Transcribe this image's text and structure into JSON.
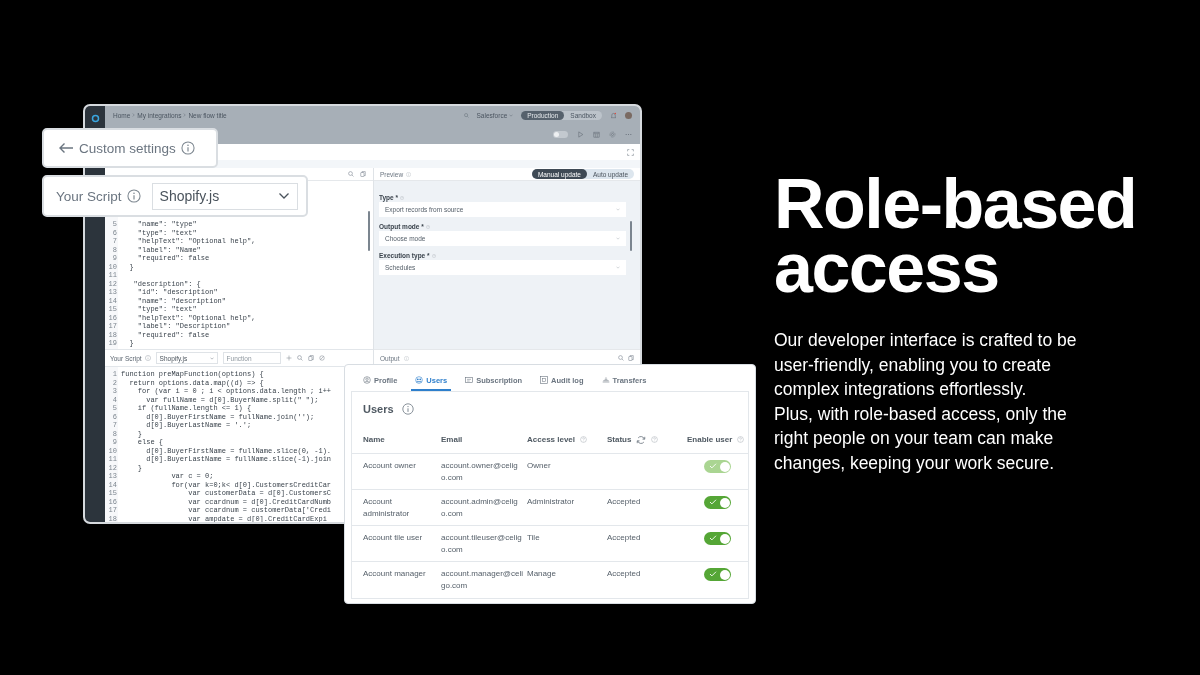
{
  "window": {
    "breadcrumb": [
      "Home",
      "My integrations",
      "New flow title"
    ],
    "account_menu": "Salesforce",
    "environments": [
      {
        "label": "Production",
        "selected": true
      },
      {
        "label": "Sandbox",
        "selected": false
      }
    ],
    "flow_toggle": {
      "on": false
    },
    "editor_lines": [
      {
        "number": "5",
        "code": "    \"name\": \"type\""
      },
      {
        "number": "6",
        "code": "    \"type\": \"text\""
      },
      {
        "number": "7",
        "code": "    \"helpText\": \"Optional help\","
      },
      {
        "number": "8",
        "code": "    \"label\": \"Name\""
      },
      {
        "number": "9",
        "code": "    \"required\": false"
      },
      {
        "number": "10",
        "code": "  }"
      },
      {
        "number": "11"
      },
      {
        "number": "12",
        "code": "   \"description\": {"
      },
      {
        "number": "13",
        "code": "    \"id\": \"description\""
      },
      {
        "number": "14",
        "code": "    \"name\": \"description\""
      },
      {
        "number": "15",
        "code": "    \"type\": \"text\""
      },
      {
        "number": "16",
        "code": "    \"helpText\": \"Optional help\","
      },
      {
        "number": "17",
        "code": "    \"label\": \"Description\""
      },
      {
        "number": "18",
        "code": "    \"required\": false"
      },
      {
        "number": "19",
        "code": "  }"
      }
    ],
    "script_bar": {
      "label": "Your Script",
      "file": "Shopify.js",
      "function_placeholder": "Function"
    },
    "script_lines": [
      {
        "number": "1",
        "code": "function preMapFunction(options) {"
      },
      {
        "number": "2",
        "code": "  return options.data.map((d) => {"
      },
      {
        "number": "3",
        "code": "    for (var i = 0 ; i < options.data.length ; i++"
      },
      {
        "number": "4",
        "code": "      var fullName = d[0].BuyerName.split(\" \");"
      },
      {
        "number": "5",
        "code": "    if (fullName.length <= 1) {"
      },
      {
        "number": "6",
        "code": "      d[0].BuyerFirstName = fullName.join('');"
      },
      {
        "number": "7",
        "code": "      d[0].BuyerLastName = '.';"
      },
      {
        "number": "8",
        "code": "    }"
      },
      {
        "number": "9",
        "code": "    else {"
      },
      {
        "number": "10",
        "code": "      d[0].BuyerFirstName = fullName.slice(0, -1)."
      },
      {
        "number": "11",
        "code": "      d[0].BuyerLastName = fullName.slice(-1).join"
      },
      {
        "number": "12",
        "code": "    }"
      },
      {
        "number": "13",
        "code": "            var c = 0;"
      },
      {
        "number": "14",
        "code": "            for(var k=0;k< d[0].CustomersCreditCar"
      },
      {
        "number": "15",
        "code": "                var customerData = d[0].CustomersC"
      },
      {
        "number": "16",
        "code": "                var ccardnum = d[0].CreditCardNumb"
      },
      {
        "number": "17",
        "code": "                var ccardnum = customerData['Credi"
      },
      {
        "number": "18",
        "code": "                var ampdate = d[0].CreditCardExpi"
      }
    ],
    "preview": {
      "title": "Preview",
      "modes": [
        {
          "label": "Manual update",
          "selected": true
        },
        {
          "label": "Auto update",
          "selected": false
        }
      ],
      "fields": [
        {
          "label": "Type *",
          "value": "Export records from source"
        },
        {
          "label": "Output mode *",
          "value": "Choose mode"
        },
        {
          "label": "Execution type *",
          "value": "Schedules"
        }
      ]
    },
    "output": {
      "title": "Output"
    }
  },
  "custom_settings": {
    "title": "Custom settings"
  },
  "script_picker": {
    "label": "Your Script",
    "value": "Shopify.js"
  },
  "users_panel": {
    "tabs": [
      {
        "label": "Profile",
        "kind": "profile",
        "selected": false
      },
      {
        "label": "Users",
        "kind": "users",
        "selected": true
      },
      {
        "label": "Subscription",
        "kind": "subscription",
        "selected": false
      },
      {
        "label": "Audit log",
        "kind": "audit",
        "selected": false
      },
      {
        "label": "Transfers",
        "kind": "transfers",
        "selected": false
      }
    ],
    "title": "Users",
    "columns": [
      {
        "label": "Name",
        "kind": "plain"
      },
      {
        "label": "Email",
        "kind": "plain"
      },
      {
        "label": "Access level",
        "kind": "help"
      },
      {
        "label": "Status",
        "kind": "refresh_help"
      },
      {
        "label": "Enable user",
        "kind": "help"
      }
    ],
    "rows": [
      {
        "name": "Account owner",
        "email": "account.owner@celigo.com",
        "access": "Owner",
        "enabled": true,
        "disabled": true
      },
      {
        "name": "Account administrator",
        "email": "account.admin@celigo.com",
        "access": "Administrator",
        "status": "Accepted",
        "enabled": true,
        "disabled": false
      },
      {
        "name": "Account tile user",
        "email": "account.tileuser@celigo.com",
        "access": "Tile",
        "status": "Accepted",
        "enabled": true,
        "disabled": false
      },
      {
        "name": "Account manager",
        "email": "account.manager@celigo.com",
        "access": "Manage",
        "status": "Accepted",
        "enabled": true,
        "disabled": false
      }
    ]
  },
  "hero": {
    "title": "Role-based access",
    "paragraphs": [
      "Our developer interface is crafted to be user-friendly, enabling you to create complex integrations effortlessly.",
      "Plus, with role-based access, only the right people on your team can make changes, keeping your work secure."
    ]
  }
}
